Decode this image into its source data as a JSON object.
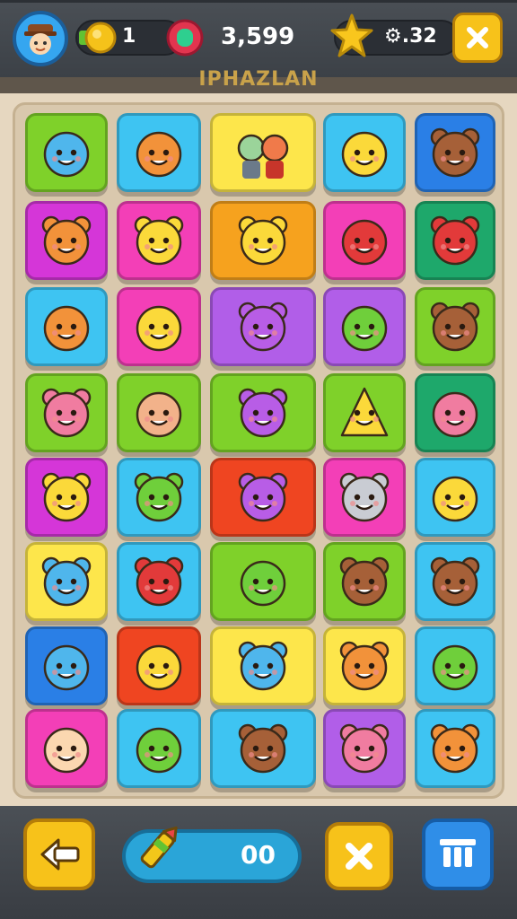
{
  "hud": {
    "coins": "1",
    "score": "3,599",
    "stars": "⚙.32"
  },
  "title": "IPHAZLAN",
  "progress": {
    "value": "00"
  },
  "colors": {
    "green": "#7fd12a",
    "blue": "#3ec4f2",
    "yellow": "#fde64b",
    "darkblue": "#2a7fe6",
    "magenta": "#d536d8",
    "pink": "#f33fb7",
    "orange": "#f6a21e",
    "teal": "#1ea86b",
    "purple": "#b15ee8",
    "red": "#ef4521"
  },
  "grid": [
    [
      {
        "bg": "green",
        "icon": "blue-bubble-face"
      },
      {
        "bg": "blue",
        "icon": "orange-fish-face"
      },
      {
        "bg": "yellow",
        "icon": "two-kids-figures"
      },
      {
        "bg": "blue",
        "icon": "yellow-blob-face"
      },
      {
        "bg": "darkblue",
        "icon": "brown-bear-face"
      }
    ],
    [
      {
        "bg": "magenta",
        "icon": "orange-cat-face"
      },
      {
        "bg": "pink",
        "icon": "yellow-bear-face"
      },
      {
        "bg": "orange",
        "icon": "yellow-cat-scene"
      },
      {
        "bg": "pink",
        "icon": "red-leaf-ball"
      },
      {
        "bg": "teal",
        "icon": "red-bear-face"
      }
    ],
    [
      {
        "bg": "blue",
        "icon": "orange-blob-face"
      },
      {
        "bg": "pink",
        "icon": "yellow-bird-face"
      },
      {
        "bg": "purple",
        "icon": "purple-bear-face"
      },
      {
        "bg": "purple",
        "icon": "green-blob-face"
      },
      {
        "bg": "green",
        "icon": "brown-bear-face"
      }
    ],
    [
      {
        "bg": "green",
        "icon": "pink-bear-face"
      },
      {
        "bg": "green",
        "icon": "peach-star-face"
      },
      {
        "bg": "green",
        "icon": "purple-bear-face"
      },
      {
        "bg": "green",
        "icon": "yellow-cone-face"
      },
      {
        "bg": "teal",
        "icon": "pink-fish-face"
      }
    ],
    [
      {
        "bg": "magenta",
        "icon": "yellow-bear-face"
      },
      {
        "bg": "blue",
        "icon": "green-bear-face"
      },
      {
        "bg": "red",
        "icon": "purple-bear-face"
      },
      {
        "bg": "pink",
        "icon": "grey-mouse-face"
      },
      {
        "bg": "blue",
        "icon": "yellow-bubble-face"
      }
    ],
    [
      {
        "bg": "yellow",
        "icon": "blue-bear-face"
      },
      {
        "bg": "blue",
        "icon": "red-bear-face"
      },
      {
        "bg": "green",
        "icon": "green-bush-face"
      },
      {
        "bg": "green",
        "icon": "brown-bear-face"
      },
      {
        "bg": "blue",
        "icon": "brown-cat-face"
      }
    ],
    [
      {
        "bg": "darkblue",
        "icon": "blue-bubble-face"
      },
      {
        "bg": "red",
        "icon": "yellow-turtle-face"
      },
      {
        "bg": "yellow",
        "icon": "blue-bear-face"
      },
      {
        "bg": "yellow",
        "icon": "orange-bear-face"
      },
      {
        "bg": "blue",
        "icon": "green-leaf-icon"
      }
    ],
    [
      {
        "bg": "pink",
        "icon": "kid-face"
      },
      {
        "bg": "blue",
        "icon": "green-blob-face"
      },
      {
        "bg": "blue",
        "icon": "brown-bear-face"
      },
      {
        "bg": "purple",
        "icon": "pink-cat-face"
      },
      {
        "bg": "blue",
        "icon": "orange-bear-face"
      }
    ]
  ]
}
